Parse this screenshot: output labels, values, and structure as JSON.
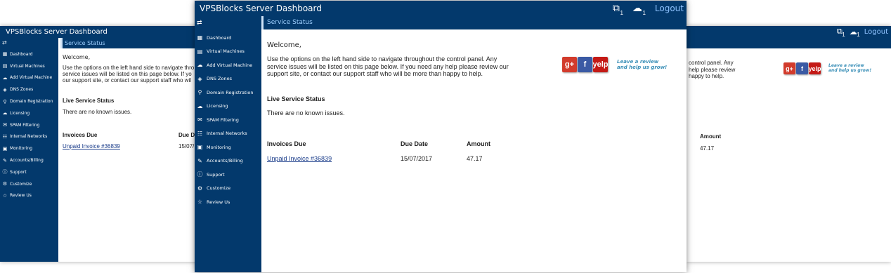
{
  "app_title": "VPSBlocks Server Dashboard",
  "header": {
    "notif_count": "1",
    "upload_count": "1",
    "logout_label": "Logout",
    "notif_icon": "tag-icon",
    "upload_icon": "cloud-upload-icon"
  },
  "sidebar": {
    "toggle_icon": "expand-collapse-icon",
    "items": [
      {
        "label": "Dashboard",
        "icon": "dashboard-icon"
      },
      {
        "label": "Virtual Machines",
        "icon": "server-icon"
      },
      {
        "label": "Add Virtual Machine",
        "icon": "add-cloud-icon"
      },
      {
        "label": "DNS Zones",
        "icon": "dns-icon"
      },
      {
        "label": "Domain Registration",
        "icon": "domain-search-icon"
      },
      {
        "label": "Licensing",
        "icon": "license-icon"
      },
      {
        "label": "SPAM Filtering",
        "icon": "spam-filter-icon"
      },
      {
        "label": "Internal Networks",
        "icon": "network-icon"
      },
      {
        "label": "Monitoring",
        "icon": "monitor-icon"
      },
      {
        "label": "Accounts/Billing",
        "icon": "billing-icon"
      },
      {
        "label": "Support",
        "icon": "help-icon"
      },
      {
        "label": "Customize",
        "icon": "customize-icon"
      },
      {
        "label": "Review Us",
        "icon": "star-icon"
      }
    ]
  },
  "section_title": "Service Status",
  "welcome": "Welcome,",
  "intro": "Use the options on the left hand side to navigate throughout the control panel. Any service issues will be listed on this page below. If you need any help please review our support site, or contact our support staff who will be more than happy to help.",
  "live_status": {
    "heading": "Live Service Status",
    "message": "There are no known issues."
  },
  "invoices": {
    "headers": [
      "Invoices Due",
      "Due Date",
      "Amount"
    ],
    "rows": [
      {
        "name": "Unpaid Invoice #36839",
        "due_date": "15/07/2017",
        "amount": "47.17"
      }
    ]
  },
  "review_banner": {
    "google_label": "g+",
    "facebook_label": "f",
    "yelp_label": "yelp",
    "text_line1": "Leave a review",
    "text_line2": "and help us grow!"
  },
  "back_panel_fragments": {
    "left_due_header": "Due D",
    "left_due_value": "15/07/",
    "left_intro_lines": [
      "Use the options on the left hand side to navigate thro",
      "service issues will be listed on this page below. If yo",
      "our support site, or contact our support staff who wil"
    ],
    "right_intro_lines": [
      "control panel. Any",
      "help please review",
      "happy to help."
    ]
  },
  "colors": {
    "navy": "#03396c",
    "section_text": "#9fd0ff",
    "link": "#1a3c8a",
    "review_text": "#3a8fb7"
  }
}
